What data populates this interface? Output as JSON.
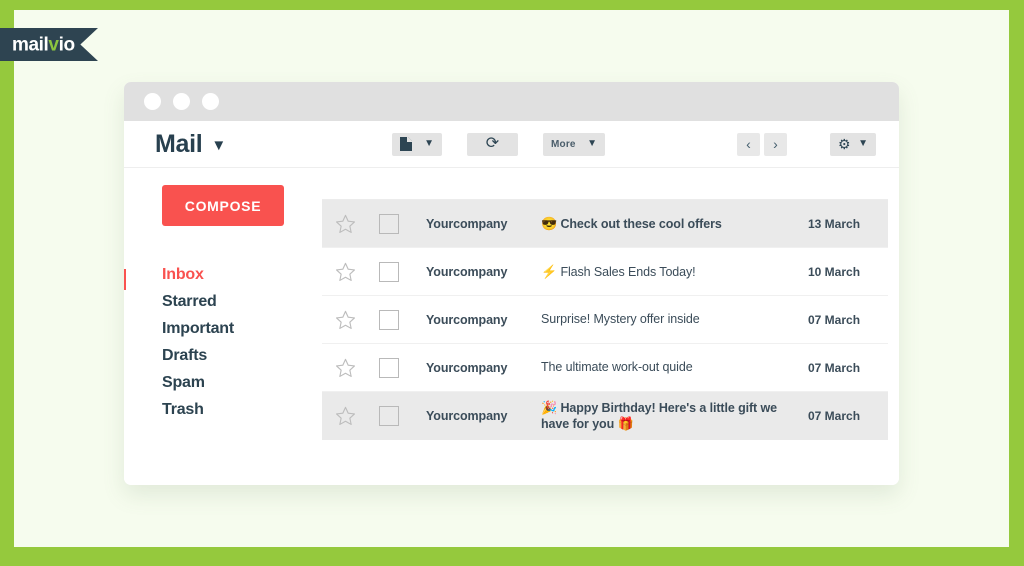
{
  "brand": {
    "logo_text_part1": "mail",
    "logo_check": "v",
    "logo_text_part2": "io",
    "ribbon_color": "#2e4451",
    "check_color": "#8cc63f",
    "frame_color": "#95c93d",
    "canvas_color": "#f6fcee"
  },
  "window": {
    "title": "Mail",
    "title_caret": "▼"
  },
  "toolbar": {
    "archive_caret": "▼",
    "archive_icon": "file-icon",
    "refresh_icon": "⟳",
    "more_label": "More",
    "more_caret": "▼",
    "prev_icon": "‹",
    "next_icon": "›",
    "gear_icon": "⚙",
    "gear_caret": "▼"
  },
  "sidebar": {
    "compose_label": "COMPOSE",
    "compose_color": "#f9524f",
    "active_folder": "Inbox",
    "folders": [
      {
        "label": "Inbox",
        "active": true
      },
      {
        "label": "Starred",
        "active": false
      },
      {
        "label": "Important",
        "active": false
      },
      {
        "label": "Drafts",
        "active": false
      },
      {
        "label": "Spam",
        "active": false
      },
      {
        "label": "Trash",
        "active": false
      }
    ]
  },
  "email_list": {
    "rows": [
      {
        "sender": "Yourcompany",
        "emoji_lead": "😎",
        "emoji_lead_name": "sunglasses-face-emoji",
        "subject": "Check out these cool offers",
        "emoji_trail": "",
        "date": "13 March",
        "unread": true,
        "starred": false,
        "checked": false
      },
      {
        "sender": "Yourcompany",
        "emoji_lead": "⚡",
        "emoji_lead_name": "lightning-bolt-emoji",
        "subject": "Flash Sales Ends Today!",
        "emoji_trail": "",
        "date": "10 March",
        "unread": false,
        "starred": false,
        "checked": false
      },
      {
        "sender": "Yourcompany",
        "emoji_lead": "",
        "emoji_lead_name": "",
        "subject": "Surprise! Mystery offer inside",
        "emoji_trail": "",
        "date": "07 March",
        "unread": false,
        "starred": false,
        "checked": false
      },
      {
        "sender": "Yourcompany",
        "emoji_lead": "",
        "emoji_lead_name": "",
        "subject": "The ultimate work-out quide",
        "emoji_trail": "",
        "date": "07 March",
        "unread": false,
        "starred": false,
        "checked": false
      },
      {
        "sender": "Yourcompany",
        "emoji_lead": "🎉",
        "emoji_lead_name": "party-popper-emoji",
        "subject": "Happy Birthday! Here's a little gift we have for you",
        "emoji_trail": "🎁",
        "emoji_trail_name": "gift-emoji",
        "date": "07 March",
        "unread": true,
        "starred": false,
        "checked": false
      }
    ]
  }
}
